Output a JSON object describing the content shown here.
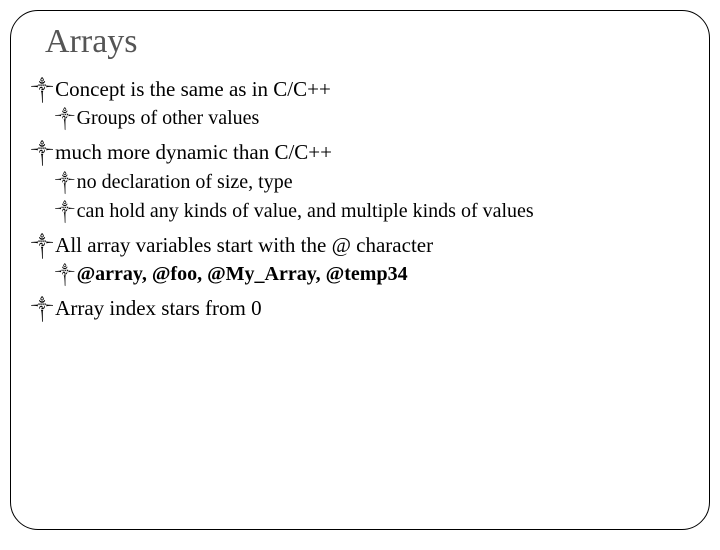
{
  "title": "Arrays",
  "items": [
    {
      "level": 1,
      "text": "Concept is the same as in C/C++",
      "bold": false
    },
    {
      "level": 2,
      "text": "Groups of other values",
      "bold": false
    },
    {
      "level": 1,
      "text": "much more dynamic than C/C++",
      "bold": false
    },
    {
      "level": 2,
      "text": "no declaration of size, type",
      "bold": false
    },
    {
      "level": 2,
      "text": "can hold any kinds of value, and multiple kinds of values",
      "bold": false
    },
    {
      "level": 1,
      "text": "All array variables start with the @ character",
      "bold": false
    },
    {
      "level": 2,
      "text": "@array, @foo, @My_Array, @temp34",
      "bold": true
    },
    {
      "level": 1,
      "text": "Array index stars from 0",
      "bold": false
    }
  ],
  "bullet_glyph": "༒"
}
